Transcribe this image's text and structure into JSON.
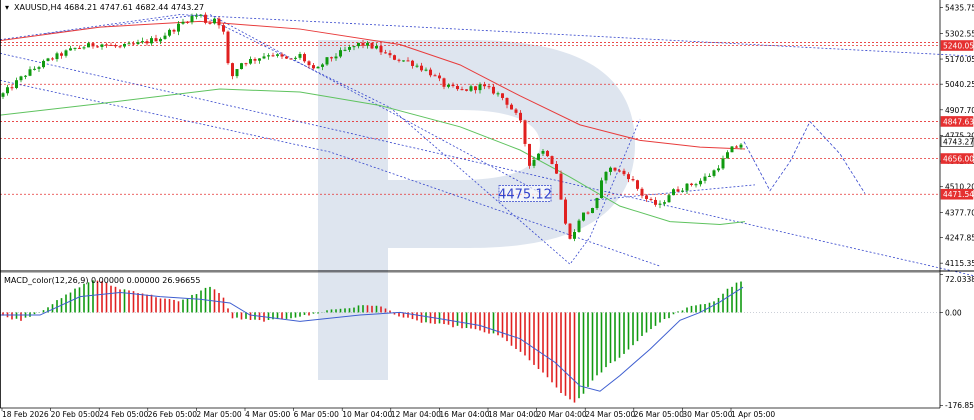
{
  "header": {
    "symbol_line": "XAUUSD,H4  4684.21 4747.61 4682.44 4743.27",
    "macd_label": "MACD_color(12,26,9) 0.00000 0.00000 26.96655"
  },
  "colors": {
    "bull": "#109a10",
    "bear": "#e02020",
    "ma_red": "#e83c3c",
    "ma_green": "#5fc35f",
    "trend_blue": "#3344cc",
    "macd_signal": "#3f5fd0",
    "level_red": "#e53030",
    "watermark": "#d8e0ec"
  },
  "chart_data": [
    {
      "type": "candlestick",
      "y_axis": {
        "ticks": [
          "5435.75",
          "5302.55",
          "5170.05",
          "5040.25",
          "4907.70",
          "4775.20",
          "4642.70",
          "4510.20",
          "4377.70",
          "4247.85",
          "4115.35"
        ],
        "ylim": [
          4080,
          5470
        ]
      },
      "x_axis": {
        "ticks": [
          "18 Feb 2026",
          "20 Feb 05:00",
          "24 Feb 05:00",
          "26 Feb 05:00",
          "2 Mar 05:00",
          "4 Mar 05:00",
          "6 Mar 05:00",
          "10 Mar 04:00",
          "12 Mar 04:00",
          "16 Mar 04:00",
          "18 Mar 04:00",
          "20 Mar 04:00",
          "24 Mar 05:00",
          "26 Mar 05:00",
          "30 Mar 05:00",
          "1 Apr 05:00"
        ]
      },
      "price_badges": [
        {
          "label": "5240.05",
          "value": 5240.05,
          "style": "red"
        },
        {
          "label": "4847.63",
          "value": 4847.63,
          "style": "red"
        },
        {
          "label": "4743.27",
          "value": 4743.27,
          "style": "current"
        },
        {
          "label": "4656.00",
          "value": 4656.0,
          "style": "red"
        },
        {
          "label": "4471.54",
          "value": 4471.54,
          "style": "red"
        }
      ],
      "extra_levels": [
        5256,
        5040,
        4760
      ],
      "annotation": {
        "text": "4475.12",
        "value": 4475.12
      },
      "anchors": [
        [
          0,
          4975
        ],
        [
          25,
          5090
        ],
        [
          50,
          5170
        ],
        [
          75,
          5225
        ],
        [
          100,
          5250
        ],
        [
          120,
          5230
        ],
        [
          140,
          5250
        ],
        [
          160,
          5280
        ],
        [
          175,
          5330
        ],
        [
          190,
          5385
        ],
        [
          200,
          5400
        ],
        [
          208,
          5350
        ],
        [
          216,
          5390
        ],
        [
          224,
          5300
        ],
        [
          230,
          5060
        ],
        [
          240,
          5150
        ],
        [
          255,
          5170
        ],
        [
          270,
          5200
        ],
        [
          290,
          5160
        ],
        [
          300,
          5190
        ],
        [
          315,
          5100
        ],
        [
          325,
          5160
        ],
        [
          340,
          5200
        ],
        [
          360,
          5250
        ],
        [
          375,
          5230
        ],
        [
          390,
          5180
        ],
        [
          410,
          5155
        ],
        [
          430,
          5100
        ],
        [
          445,
          5030
        ],
        [
          460,
          5005
        ],
        [
          480,
          5030
        ],
        [
          495,
          5000
        ],
        [
          505,
          4960
        ],
        [
          520,
          4850
        ],
        [
          530,
          4620
        ],
        [
          540,
          4700
        ],
        [
          548,
          4680
        ],
        [
          556,
          4600
        ],
        [
          565,
          4320
        ],
        [
          572,
          4230
        ],
        [
          580,
          4360
        ],
        [
          588,
          4380
        ],
        [
          596,
          4420
        ],
        [
          605,
          4600
        ],
        [
          615,
          4600
        ],
        [
          630,
          4560
        ],
        [
          640,
          4480
        ],
        [
          650,
          4430
        ],
        [
          660,
          4410
        ],
        [
          670,
          4480
        ],
        [
          685,
          4510
        ],
        [
          700,
          4540
        ],
        [
          712,
          4580
        ],
        [
          722,
          4640
        ],
        [
          730,
          4700
        ],
        [
          738,
          4720
        ],
        [
          744,
          4743.27
        ]
      ],
      "moving_averages": [
        {
          "color_key": "ma_red",
          "points": [
            [
              0,
              5265
            ],
            [
              100,
              5335
            ],
            [
              200,
              5365
            ],
            [
              300,
              5325
            ],
            [
              400,
              5245
            ],
            [
              460,
              5140
            ],
            [
              520,
              4980
            ],
            [
              580,
              4830
            ],
            [
              640,
              4750
            ],
            [
              700,
              4715
            ],
            [
              745,
              4705
            ]
          ]
        },
        {
          "color_key": "ma_green",
          "points": [
            [
              0,
              4880
            ],
            [
              100,
              4940
            ],
            [
              220,
              5015
            ],
            [
              300,
              5000
            ],
            [
              380,
              4930
            ],
            [
              460,
              4820
            ],
            [
              520,
              4700
            ],
            [
              570,
              4560
            ],
            [
              620,
              4410
            ],
            [
              670,
              4330
            ],
            [
              720,
              4315
            ],
            [
              745,
              4330
            ]
          ]
        }
      ],
      "trendlines": [
        {
          "style": "dotted",
          "points": [
            [
              0,
              5270
            ],
            [
              180,
              5400
            ],
            [
              974,
              5185
            ]
          ]
        },
        {
          "style": "dotted",
          "points": [
            [
              0,
              5200
            ],
            [
              974,
              4050
            ]
          ]
        },
        {
          "style": "dotted",
          "points": [
            [
              0,
              5060
            ],
            [
              330,
              4690
            ],
            [
              660,
              4100
            ]
          ]
        },
        {
          "style": "dotted",
          "points": [
            [
              45,
              5300
            ],
            [
              200,
              5400
            ],
            [
              390,
              4920
            ],
            [
              570,
              4110
            ],
            [
              590,
              4250
            ],
            [
              640,
              4860
            ]
          ]
        },
        {
          "style": "dotted",
          "points": [
            [
              210,
              5400
            ],
            [
              540,
              4480
            ]
          ]
        },
        {
          "style": "dotted",
          "points": [
            [
              590,
              4440
            ],
            [
              755,
              4520
            ]
          ]
        }
      ],
      "forecast_path": [
        [
          744,
          4743
        ],
        [
          770,
          4490
        ],
        [
          790,
          4640
        ],
        [
          810,
          4847
        ],
        [
          840,
          4680
        ],
        [
          865,
          4475
        ]
      ]
    },
    {
      "type": "bar",
      "title": "MACD_color(12,26,9)",
      "y_axis": {
        "ticks": [
          "72.03388",
          "0.00",
          "-176.8598"
        ],
        "ylim": [
          -180,
          75
        ]
      },
      "series": [
        {
          "name": "histogram",
          "anchors": [
            [
              0,
              -6
            ],
            [
              20,
              -15
            ],
            [
              40,
              2
            ],
            [
              60,
              25
            ],
            [
              80,
              50
            ],
            [
              95,
              63
            ],
            [
              105,
              56
            ],
            [
              120,
              45
            ],
            [
              140,
              38
            ],
            [
              160,
              28
            ],
            [
              180,
              20
            ],
            [
              195,
              35
            ],
            [
              210,
              50
            ],
            [
              222,
              33
            ],
            [
              232,
              -10
            ],
            [
              250,
              -15
            ],
            [
              270,
              -16
            ],
            [
              290,
              -10
            ],
            [
              310,
              -5
            ],
            [
              330,
              5
            ],
            [
              350,
              9
            ],
            [
              370,
              15
            ],
            [
              385,
              8
            ],
            [
              400,
              -8
            ],
            [
              420,
              -18
            ],
            [
              440,
              -23
            ],
            [
              460,
              -28
            ],
            [
              480,
              -35
            ],
            [
              500,
              -45
            ],
            [
              520,
              -75
            ],
            [
              540,
              -110
            ],
            [
              555,
              -140
            ],
            [
              565,
              -160
            ],
            [
              575,
              -172
            ],
            [
              585,
              -150
            ],
            [
              595,
              -125
            ],
            [
              610,
              -98
            ],
            [
              625,
              -78
            ],
            [
              640,
              -48
            ],
            [
              655,
              -25
            ],
            [
              670,
              -8
            ],
            [
              685,
              8
            ],
            [
              700,
              14
            ],
            [
              715,
              22
            ],
            [
              730,
              48
            ],
            [
              743,
              62
            ]
          ]
        },
        {
          "name": "signal",
          "anchors": [
            [
              0,
              -5
            ],
            [
              40,
              -5
            ],
            [
              80,
              30
            ],
            [
              120,
              38
            ],
            [
              160,
              30
            ],
            [
              200,
              25
            ],
            [
              230,
              18
            ],
            [
              250,
              -5
            ],
            [
              300,
              -17
            ],
            [
              360,
              -5
            ],
            [
              400,
              0
            ],
            [
              440,
              -12
            ],
            [
              480,
              -25
            ],
            [
              520,
              -50
            ],
            [
              555,
              -95
            ],
            [
              580,
              -140
            ],
            [
              600,
              -150
            ],
            [
              620,
              -120
            ],
            [
              650,
              -70
            ],
            [
              680,
              -15
            ],
            [
              700,
              0
            ],
            [
              720,
              20
            ],
            [
              743,
              48
            ]
          ]
        }
      ]
    }
  ]
}
